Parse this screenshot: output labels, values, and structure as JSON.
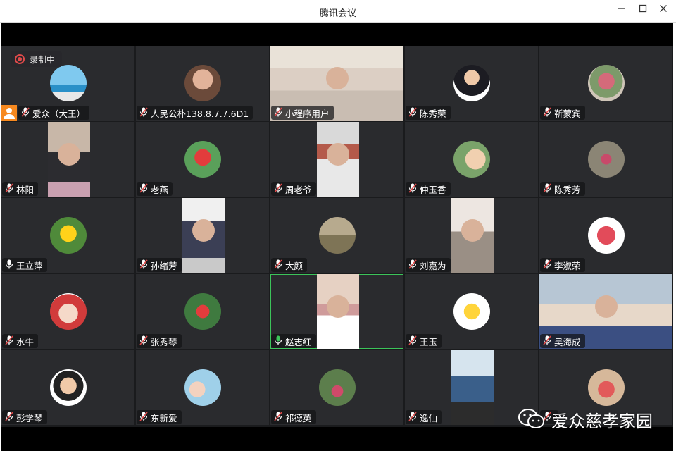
{
  "window": {
    "title": "腾讯会议",
    "minimize_icon": "minimize-icon",
    "maximize_icon": "maximize-icon",
    "close_icon": "close-icon"
  },
  "recording": {
    "label": "录制中",
    "icon": "record-icon"
  },
  "participants": [
    {
      "name": "爱众（大王）",
      "host": true,
      "mic": "muted"
    },
    {
      "name": "人民公朴138.8.7.7.6D1",
      "mic": "muted"
    },
    {
      "name": "小程序用户",
      "mic": "muted"
    },
    {
      "name": "陈秀荣",
      "mic": "muted"
    },
    {
      "name": "靳蒙宾",
      "mic": "muted"
    },
    {
      "name": "林阳",
      "mic": "muted"
    },
    {
      "name": "老燕",
      "mic": "muted"
    },
    {
      "name": "周老爷",
      "mic": "muted"
    },
    {
      "name": "仲玉香",
      "mic": "muted"
    },
    {
      "name": "陈秀芳",
      "mic": "muted"
    },
    {
      "name": "王立萍",
      "mic": "on"
    },
    {
      "name": "孙绪芳",
      "mic": "muted"
    },
    {
      "name": "大颜",
      "mic": "muted"
    },
    {
      "name": "刘嘉为",
      "mic": "muted"
    },
    {
      "name": "李淑荣",
      "mic": "muted"
    },
    {
      "name": "水牛",
      "mic": "muted"
    },
    {
      "name": "张秀琴",
      "mic": "muted"
    },
    {
      "name": "赵志红",
      "mic": "speaking",
      "active": true
    },
    {
      "name": "王玉",
      "mic": "muted"
    },
    {
      "name": "吴海成",
      "mic": "muted"
    },
    {
      "name": "彭学琴",
      "mic": "muted"
    },
    {
      "name": "东新爱",
      "mic": "muted"
    },
    {
      "name": "祁德英",
      "mic": "muted"
    },
    {
      "name": "逸仙",
      "mic": "muted"
    },
    {
      "name": "",
      "mic": "muted"
    }
  ],
  "watermark": {
    "text": "爱众慈孝家园",
    "icon": "wechat-icon"
  },
  "colors": {
    "speaking": "#3cc45a",
    "muted": "#e04a4a",
    "host_badge": "#f7891f",
    "tile_bg": "#2a2b2e"
  }
}
